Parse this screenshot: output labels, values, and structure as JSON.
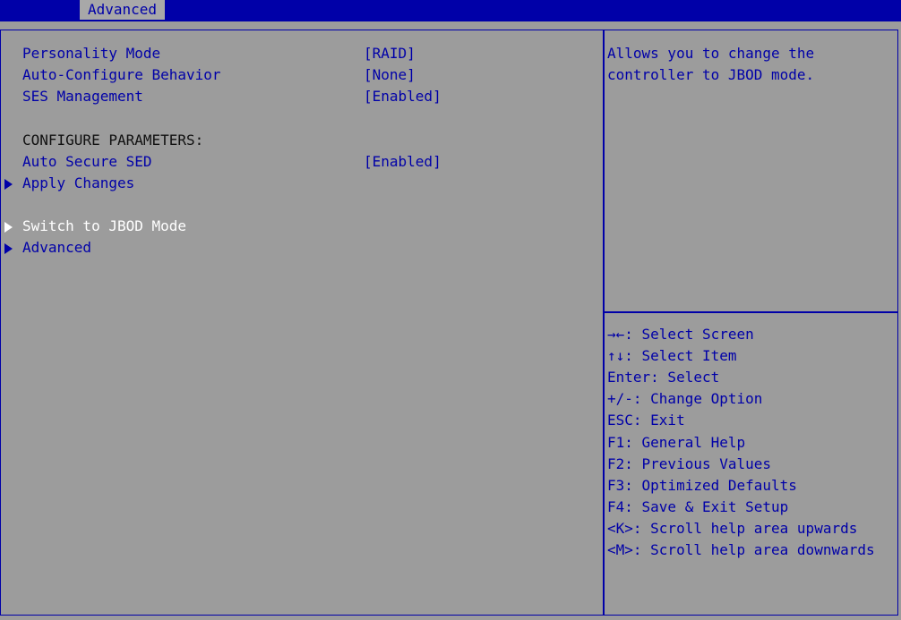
{
  "header": {
    "tab_label": "Advanced"
  },
  "settings": [
    {
      "label": "Personality Mode",
      "value": "[RAID]"
    },
    {
      "label": "Auto-Configure Behavior",
      "value": "[None]"
    },
    {
      "label": "SES Management",
      "value": "[Enabled]"
    }
  ],
  "section_heading": "CONFIGURE PARAMETERS:",
  "auto_secure": {
    "label": "Auto Secure SED",
    "value": "[Enabled]"
  },
  "submenus": {
    "apply_changes": "Apply Changes",
    "switch_jbod": "Switch to JBOD Mode",
    "advanced": "Advanced"
  },
  "help_text": [
    "Allows you to change the",
    "controller to JBOD mode."
  ],
  "key_help": [
    "→←: Select Screen",
    "↑↓: Select Item",
    "Enter: Select",
    "+/-: Change Option",
    "ESC: Exit",
    "F1: General Help",
    "F2: Previous Values",
    "F3: Optimized Defaults",
    "F4: Save & Exit Setup",
    "<K>: Scroll help area upwards",
    "<M>: Scroll help area downwards"
  ],
  "colors": {
    "accent": "#0000a8",
    "background": "#9c9c9c",
    "selected": "#ffffff"
  },
  "icons": {
    "submenu_marker": "triangle-right-icon"
  }
}
